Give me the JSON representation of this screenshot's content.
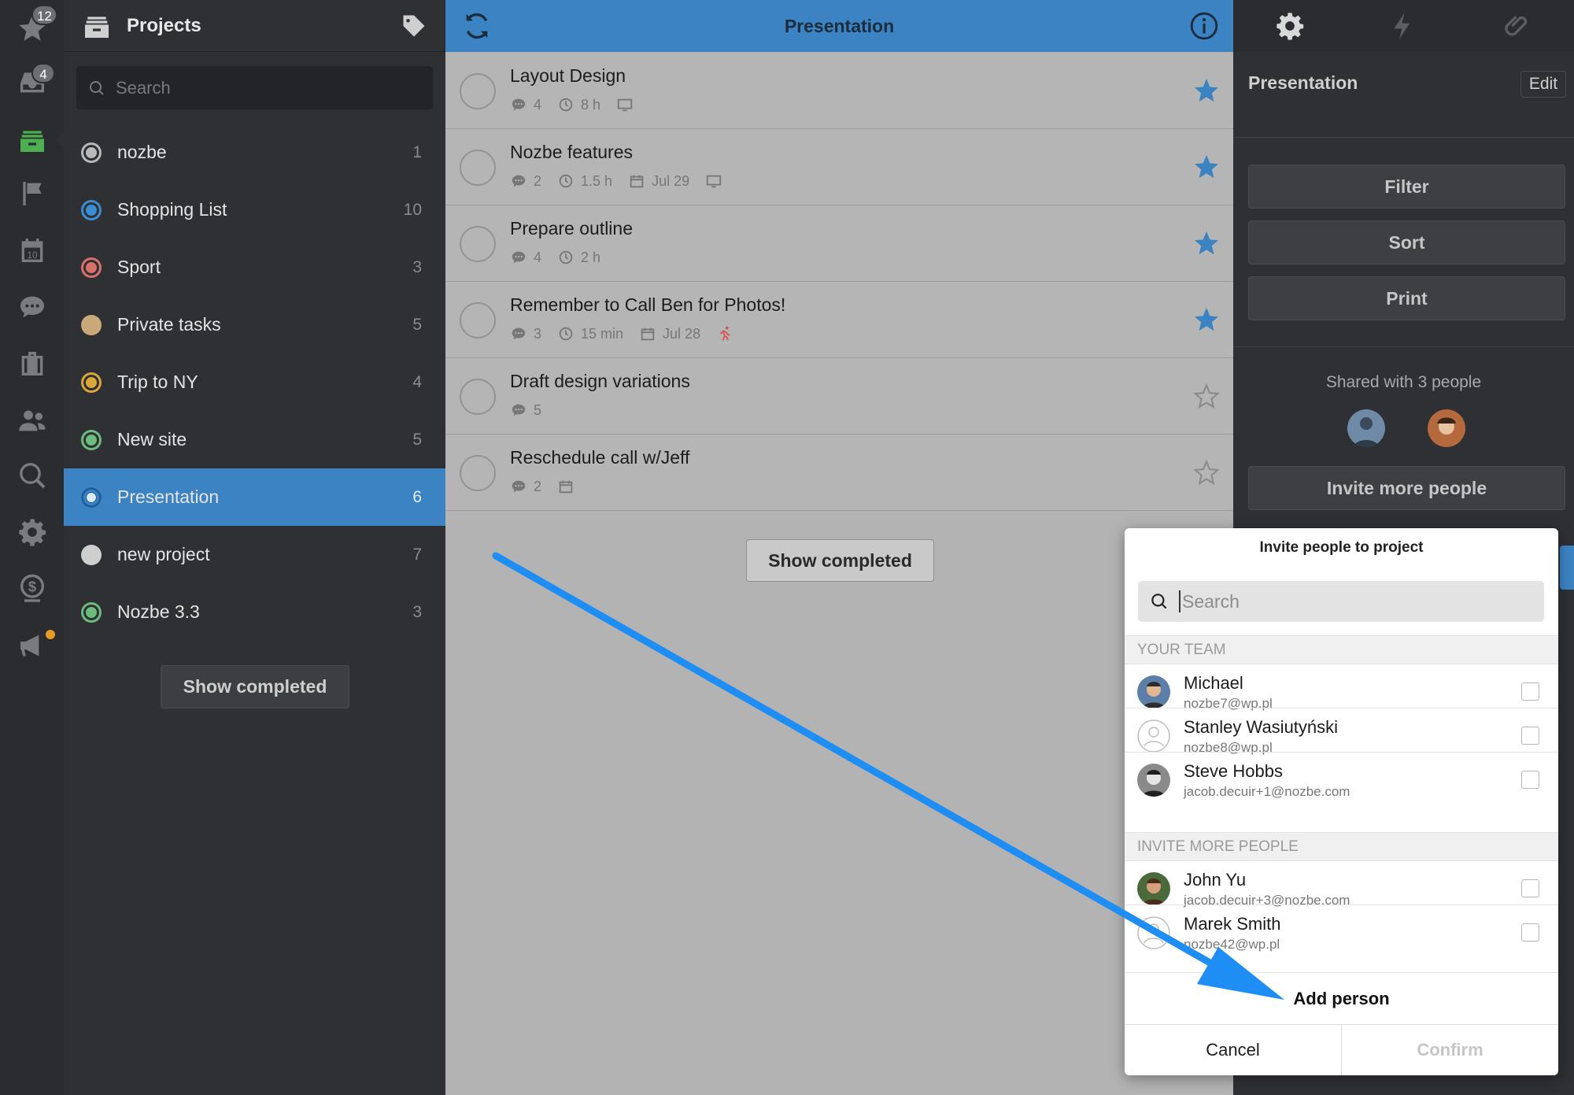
{
  "rail": {
    "priority_badge": "12",
    "inbox_badge": "4"
  },
  "projects": {
    "header_title": "Projects",
    "search_placeholder": "Search",
    "items": [
      {
        "name": "nozbe",
        "count": "1",
        "color": "#b9b9b9"
      },
      {
        "name": "Shopping List",
        "count": "10",
        "color": "#3c8ed4"
      },
      {
        "name": "Sport",
        "count": "3",
        "color": "#d9706a"
      },
      {
        "name": "Private tasks",
        "count": "5",
        "color": "#c9a97a"
      },
      {
        "name": "Trip to NY",
        "count": "4",
        "color": "#d9a73a"
      },
      {
        "name": "New site",
        "count": "5",
        "color": "#6dbb7d"
      },
      {
        "name": "Presentation",
        "count": "6",
        "color": "#1e5d99"
      },
      {
        "name": "new project",
        "count": "7",
        "color": "#cfcfcf"
      },
      {
        "name": "Nozbe 3.3",
        "count": "3",
        "color": "#6dbb7d"
      }
    ],
    "show_completed": "Show completed"
  },
  "main": {
    "title": "Presentation",
    "tasks": [
      {
        "title": "Layout Design",
        "comments": "4",
        "time": "8 h",
        "date": ""
      },
      {
        "title": "Nozbe features",
        "comments": "2",
        "time": "1.5 h",
        "date": "Jul 29"
      },
      {
        "title": "Prepare outline",
        "comments": "4",
        "time": "2 h",
        "date": ""
      },
      {
        "title": "Remember to Call Ben for Photos!",
        "comments": "3",
        "time": "15 min",
        "date": "Jul 28"
      },
      {
        "title": "Draft design variations",
        "comments": "5",
        "time": "",
        "date": ""
      },
      {
        "title": "Reschedule call w/Jeff",
        "comments": "2",
        "time": "",
        "date": ""
      }
    ],
    "show_completed": "Show completed",
    "accent_color": "#3c83c3"
  },
  "right": {
    "title": "Presentation",
    "edit_label": "Edit",
    "filter_label": "Filter",
    "sort_label": "Sort",
    "print_label": "Print",
    "shared_text": "Shared with 3 people",
    "invite_label": "Invite more people"
  },
  "invite_dialog": {
    "title": "Invite people to project",
    "search_placeholder": "Search",
    "team_header": "YOUR TEAM",
    "more_header": "INVITE MORE PEOPLE",
    "team": [
      {
        "name": "Michael",
        "email": "nozbe7@wp.pl"
      },
      {
        "name": "Stanley Wasiutyński",
        "email": "nozbe8@wp.pl"
      },
      {
        "name": "Steve Hobbs",
        "email": "jacob.decuir+1@nozbe.com"
      }
    ],
    "more": [
      {
        "name": "John Yu",
        "email": "jacob.decuir+3@nozbe.com"
      },
      {
        "name": "Marek Smith",
        "email": "nozbe42@wp.pl"
      }
    ],
    "add_person": "Add person",
    "cancel": "Cancel",
    "confirm": "Confirm"
  }
}
